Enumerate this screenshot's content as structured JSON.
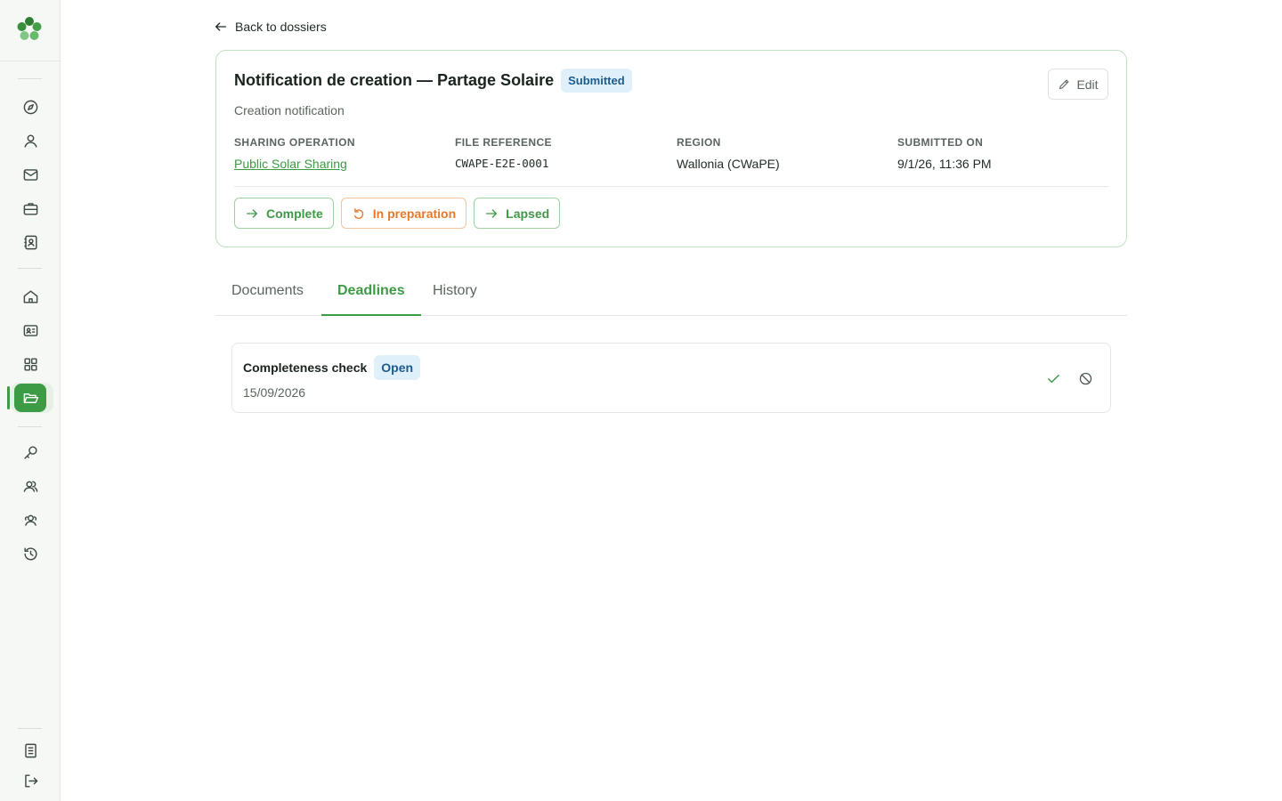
{
  "sidebar": {
    "logo": "clover-logo",
    "items": [
      {
        "name": "compass-icon"
      },
      {
        "name": "user-icon"
      },
      {
        "name": "mail-icon"
      },
      {
        "name": "briefcase-icon"
      },
      {
        "name": "contact-book-icon"
      },
      {
        "name": "home-icon"
      },
      {
        "name": "id-card-icon"
      },
      {
        "name": "grid-icon"
      },
      {
        "name": "folder-open-icon",
        "active": true
      },
      {
        "name": "key-icon"
      },
      {
        "name": "users-icon"
      },
      {
        "name": "users-group-icon"
      },
      {
        "name": "history-icon"
      },
      {
        "name": "document-icon"
      },
      {
        "name": "logout-icon"
      }
    ]
  },
  "back_link": "Back to dossiers",
  "dossier": {
    "title": "Notification de creation — Partage Solaire",
    "status": "Submitted",
    "subtitle": "Creation notification",
    "edit_label": "Edit",
    "fields": [
      {
        "label": "Sharing operation",
        "value": "Public Solar Sharing"
      },
      {
        "label": "File reference",
        "value": "CWAPE-E2E-0001"
      },
      {
        "label": "Region",
        "value": "Wallonia (CWaPE)"
      },
      {
        "label": "Submitted on",
        "value": "9/1/26, 11:36 PM"
      }
    ],
    "actions": [
      {
        "label": "Complete",
        "color": "#3d9a45"
      },
      {
        "label": "In preparation",
        "color": "#e4792b"
      },
      {
        "label": "Lapsed",
        "color": "#3d9a45"
      }
    ]
  },
  "tabs": [
    {
      "label": "Documents"
    },
    {
      "label": "Deadlines",
      "active": true
    },
    {
      "label": "History"
    }
  ],
  "deadlines": [
    {
      "title": "Completeness check",
      "status": "Open",
      "date": "15/09/2026"
    }
  ],
  "colors": {
    "accent": "#3d9a45",
    "warning": "#e4792b",
    "info_bg": "#dff0fb",
    "info_text": "#1e5a8a"
  }
}
